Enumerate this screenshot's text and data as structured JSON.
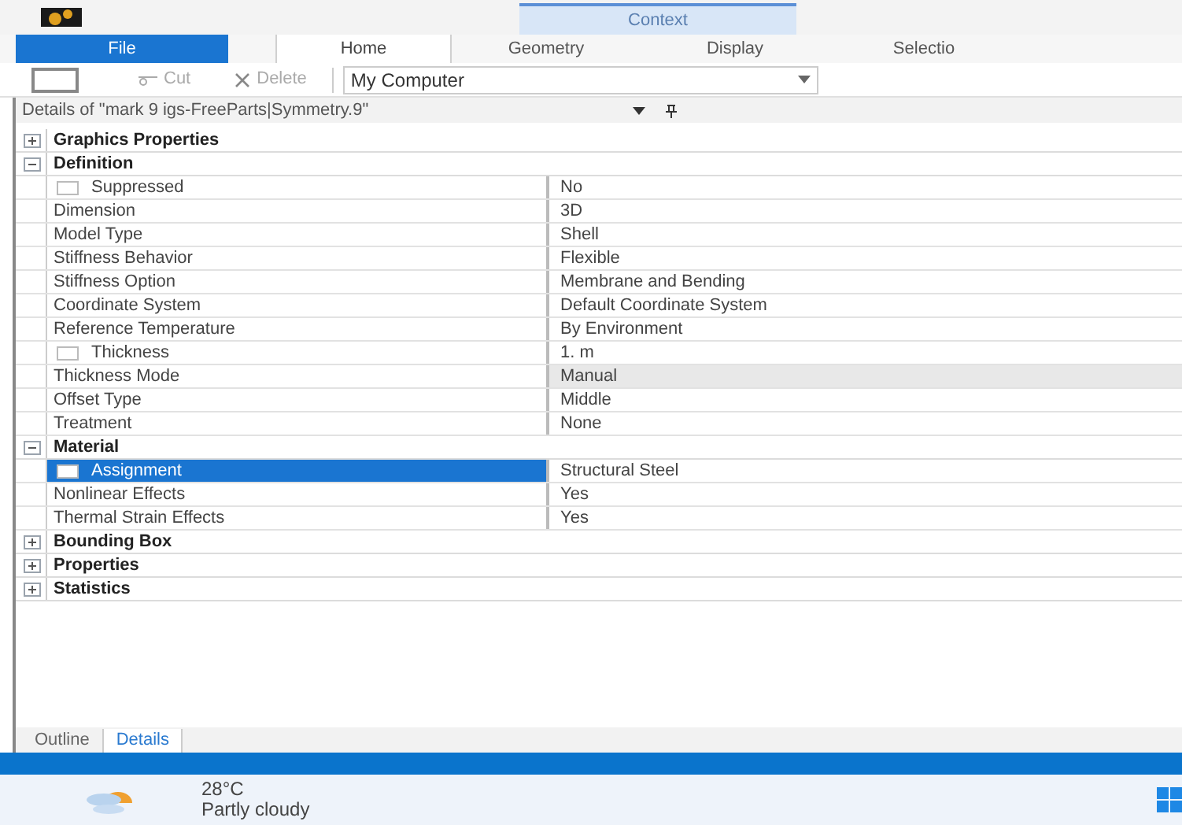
{
  "context_tab": {
    "label": "Context"
  },
  "ribbon_tabs": [
    {
      "label": "File",
      "kind": "file"
    },
    {
      "label": "Home",
      "kind": "tab",
      "selected": true
    },
    {
      "label": "Geometry",
      "kind": "tab",
      "selected": false
    },
    {
      "label": "Display",
      "kind": "tab",
      "selected": false
    },
    {
      "label": "Selectio",
      "kind": "tab",
      "selected": false
    }
  ],
  "toolbar": {
    "cut": {
      "label": "Cut",
      "disabled": true
    },
    "delete": {
      "label": "Delete",
      "disabled": true
    },
    "dropdown": {
      "value": "My Computer"
    }
  },
  "details": {
    "title": "Details of \"mark 9 igs-FreeParts|Symmetry.9\"",
    "groups": [
      {
        "label": "Graphics Properties",
        "expanded": false
      },
      {
        "label": "Definition",
        "expanded": true,
        "rows": [
          {
            "name": "Suppressed",
            "value": "No",
            "kind": "checkbox",
            "selected": false,
            "highlighted": false
          },
          {
            "name": "Dimension",
            "value": "3D",
            "kind": "plain",
            "selected": false,
            "highlighted": false
          },
          {
            "name": "Model Type",
            "value": "Shell",
            "kind": "plain",
            "selected": false,
            "highlighted": false
          },
          {
            "name": "Stiffness Behavior",
            "value": "Flexible",
            "kind": "plain",
            "selected": false,
            "highlighted": false
          },
          {
            "name": "Stiffness Option",
            "value": "Membrane and Bending",
            "kind": "plain",
            "selected": false,
            "highlighted": false
          },
          {
            "name": "Coordinate System",
            "value": "Default Coordinate System",
            "kind": "plain",
            "selected": false,
            "highlighted": false
          },
          {
            "name": "Reference Temperature",
            "value": "By Environment",
            "kind": "plain",
            "selected": false,
            "highlighted": false
          },
          {
            "name": "Thickness",
            "value": "1. m",
            "kind": "checkbox",
            "selected": false,
            "highlighted": false
          },
          {
            "name": "Thickness Mode",
            "value": "Manual",
            "kind": "plain",
            "selected": false,
            "highlighted": true
          },
          {
            "name": "Offset Type",
            "value": "Middle",
            "kind": "plain",
            "selected": false,
            "highlighted": false
          },
          {
            "name": "Treatment",
            "value": "None",
            "kind": "plain",
            "selected": false,
            "highlighted": false
          }
        ]
      },
      {
        "label": "Material",
        "expanded": true,
        "rows": [
          {
            "name": "Assignment",
            "value": "Structural Steel",
            "kind": "checkbox",
            "selected": true,
            "highlighted": false
          },
          {
            "name": "Nonlinear Effects",
            "value": "Yes",
            "kind": "plain",
            "selected": false,
            "highlighted": false
          },
          {
            "name": "Thermal Strain Effects",
            "value": "Yes",
            "kind": "plain",
            "selected": false,
            "highlighted": false
          }
        ]
      },
      {
        "label": "Bounding Box",
        "expanded": false
      },
      {
        "label": "Properties",
        "expanded": false
      },
      {
        "label": "Statistics",
        "expanded": false
      }
    ]
  },
  "bottom_tabs": [
    {
      "label": "Outline",
      "selected": false
    },
    {
      "label": "Details",
      "selected": true
    }
  ],
  "weather": {
    "temperature": "28°C",
    "condition": "Partly cloudy"
  }
}
